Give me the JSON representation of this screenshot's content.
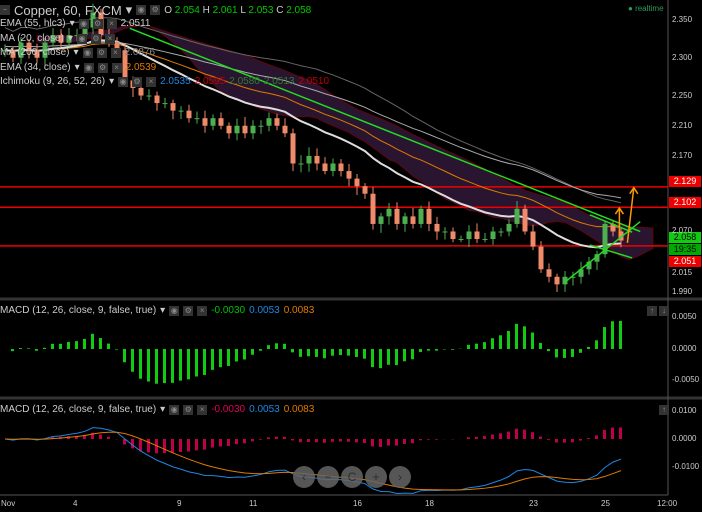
{
  "header": {
    "symbol": "Copper, 60, FXCM",
    "o_label": "O",
    "o": "2.054",
    "h_label": "H",
    "h": "2.061",
    "l_label": "L",
    "l": "2.053",
    "c_label": "C",
    "c": "2.058",
    "realtime": "realtime"
  },
  "indicators": [
    {
      "label": "EMA (55, hlc3)",
      "value": "2.0511",
      "color": "#cccccc"
    },
    {
      "label": "MA (20, close)",
      "value": "",
      "color": "#cccccc"
    },
    {
      "label": "MA (200, close)",
      "value": "2.0876",
      "color": "#888888"
    },
    {
      "label": "EMA (34, close)",
      "value": "2.0539",
      "color": "#e07b00"
    },
    {
      "label": "Ichimoku (9, 26, 52, 26)",
      "values": [
        "2.0535",
        "2.0595",
        "2.0580",
        "2.0513",
        "2.0510"
      ],
      "colors": [
        "#1e88e5",
        "#c00000",
        "#2e7d32",
        "#2e7d32",
        "#c00000"
      ]
    }
  ],
  "macd1": {
    "label": "MACD (12, 26, close, 9, false, true)",
    "values": [
      "-0.0030",
      "0.0053",
      "0.0083"
    ],
    "colors": [
      "#00c000",
      "#1e88e5",
      "#e07b00"
    ],
    "ticks": [
      "0.0050",
      "0.0000",
      "-0.0050"
    ]
  },
  "macd2": {
    "label": "MACD (12, 26, close, 9, false, true)",
    "values": [
      "-0.0030",
      "0.0053",
      "0.0083"
    ],
    "colors": [
      "#e0005a",
      "#1e88e5",
      "#e07b00"
    ],
    "ticks": [
      "0.0100",
      "0.0000",
      "-0.0100"
    ]
  },
  "price_badges": {
    "r1": "2.129",
    "r2": "2.102",
    "last": "2.058",
    "countdown": "19:35",
    "s1": "2.051"
  },
  "nav": {
    "back": "‹",
    "minus": "−",
    "reset": "C",
    "plus": "+",
    "fwd": "›"
  },
  "chart_data": {
    "type": "candlestick",
    "title": "Copper, 60, FXCM",
    "price_ticks": [
      "2.350",
      "2.300",
      "2.250",
      "2.210",
      "2.170",
      "2.070",
      "2.015",
      "1.990"
    ],
    "price_tick_values": [
      2.35,
      2.3,
      2.25,
      2.21,
      2.17,
      2.07,
      2.015,
      1.99
    ],
    "ylim": [
      1.975,
      2.37
    ],
    "x_labels": [
      "Nov",
      "4",
      "9",
      "11",
      "16",
      "18",
      "23",
      "25",
      "12:00"
    ],
    "x_label_index": [
      0,
      9,
      22,
      31,
      44,
      53,
      66,
      75,
      82
    ],
    "closes": [
      2.31,
      2.3,
      2.32,
      2.31,
      2.3,
      2.32,
      2.33,
      2.32,
      2.33,
      2.33,
      2.34,
      2.36,
      2.33,
      2.32,
      2.31,
      2.27,
      2.26,
      2.25,
      2.25,
      2.24,
      2.24,
      2.23,
      2.23,
      2.22,
      2.22,
      2.21,
      2.22,
      2.21,
      2.2,
      2.21,
      2.2,
      2.21,
      2.21,
      2.22,
      2.21,
      2.2,
      2.16,
      2.16,
      2.17,
      2.16,
      2.15,
      2.16,
      2.15,
      2.14,
      2.13,
      2.12,
      2.08,
      2.09,
      2.1,
      2.08,
      2.09,
      2.08,
      2.1,
      2.08,
      2.07,
      2.07,
      2.06,
      2.06,
      2.07,
      2.06,
      2.06,
      2.07,
      2.07,
      2.08,
      2.1,
      2.07,
      2.05,
      2.02,
      2.01,
      2.0,
      2.01,
      2.01,
      2.02,
      2.03,
      2.04,
      2.08,
      2.07,
      2.058
    ],
    "horizontal_levels": [
      2.129,
      2.102,
      2.051
    ],
    "trendlines": [
      [
        [
          15.6,
          2.339
        ],
        [
          79.4,
          2.07
        ]
      ],
      [
        [
          73.1,
          2.092
        ],
        [
          78.4,
          2.069
        ]
      ],
      [
        [
          70,
          2.003
        ],
        [
          79.4,
          2.083
        ]
      ],
      [
        [
          73.1,
          2.052
        ],
        [
          78.4,
          2.035
        ]
      ]
    ],
    "arrows": [
      [
        [
          76.8,
          2.065
        ],
        [
          76.8,
          2.101
        ]
      ],
      [
        [
          77.8,
          2.055
        ],
        [
          78.6,
          2.128
        ]
      ]
    ]
  }
}
